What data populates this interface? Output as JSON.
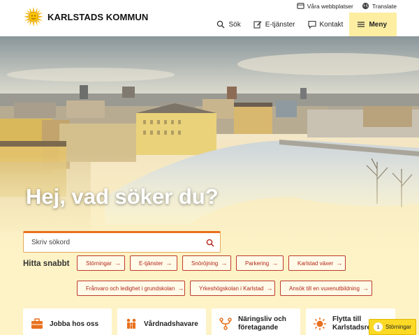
{
  "header": {
    "brand": "KARLSTADS KOMMUN",
    "utility": [
      {
        "label": "Våra webbplatser",
        "icon": "websites-icon"
      },
      {
        "label": "Translate",
        "icon": "globe-icon"
      }
    ],
    "nav": [
      {
        "label": "Sök",
        "icon": "search-icon"
      },
      {
        "label": "E-tjänster",
        "icon": "edit-icon"
      },
      {
        "label": "Kontakt",
        "icon": "chat-icon"
      },
      {
        "label": "Meny",
        "icon": "hamburger-icon"
      }
    ]
  },
  "hero": {
    "title": "Hej, vad söker du?",
    "search_placeholder": "Skriv sökord"
  },
  "quick": {
    "label": "Hitta snabbt",
    "links": [
      "Störningar",
      "E-tjänster",
      "Snöröjning",
      "Parkering",
      "Karlstad växer",
      "Frånvaro och ledighet i grundskolan",
      "Yrkeshögskolan i Karlstad",
      "Ansök till en vuxenutbildning"
    ],
    "arrow": "→"
  },
  "cards": [
    {
      "label": "Jobba hos oss",
      "icon": "briefcase-icon"
    },
    {
      "label": "Vårdnadshavare",
      "icon": "family-icon"
    },
    {
      "label": "Näringsliv och företagande",
      "icon": "network-icon"
    },
    {
      "label": "Flytta till Karlstadsregionen",
      "icon": "sun-icon"
    }
  ],
  "disturbance": {
    "count": "1",
    "label": "Störningar"
  },
  "colors": {
    "accent_red": "#b3251b",
    "accent_yellow": "#fbd924",
    "menu_bg": "#fdeea2",
    "quick_bg": "#fdf3c6"
  }
}
